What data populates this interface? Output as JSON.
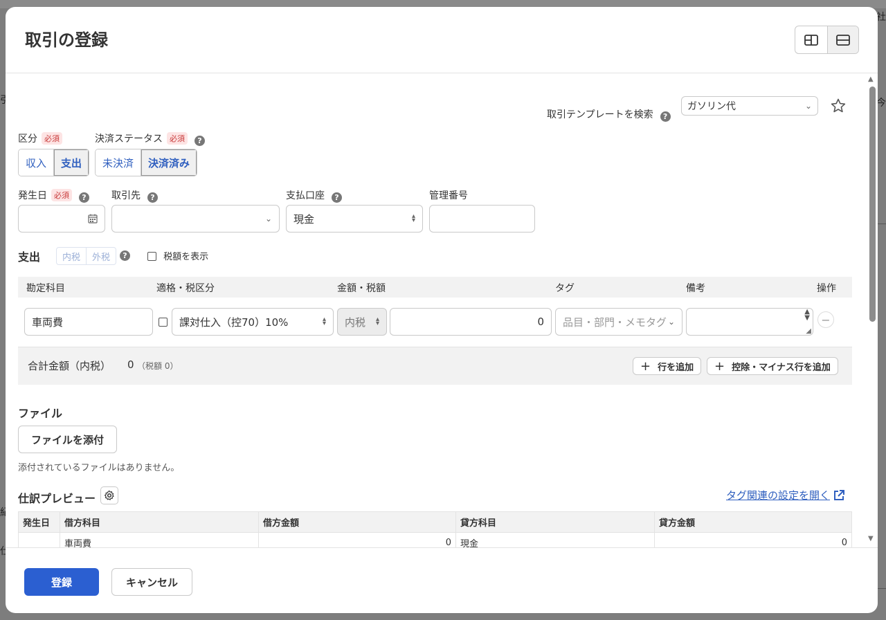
{
  "modal": {
    "title": "取引の登録"
  },
  "template_search": {
    "label": "取引テンプレートを検索",
    "value": "ガソリン代"
  },
  "kubun": {
    "label": "区分",
    "required": "必須",
    "options": [
      "収入",
      "支出"
    ],
    "selected": "支出"
  },
  "status": {
    "label": "決済ステータス",
    "required": "必須",
    "options": [
      "未決済",
      "決済済み"
    ],
    "selected": "決済済み"
  },
  "fields": {
    "date_label": "発生日",
    "date_required": "必須",
    "date_value": "",
    "partner_label": "取引先",
    "partner_value": "",
    "account_label": "支払口座",
    "account_value": "現金",
    "mgmt_label": "管理番号",
    "mgmt_value": ""
  },
  "expense": {
    "title": "支出",
    "tax_options": [
      "内税",
      "外税"
    ],
    "show_tax_label": "税額を表示",
    "columns": [
      "勘定科目",
      "適格・税区分",
      "金額・税額",
      "タグ",
      "備考",
      "操作"
    ],
    "row": {
      "account": "車両費",
      "tax_class": "課対仕入（控70）10%",
      "tax_mode": "内税",
      "amount": "0",
      "tag_placeholder": "品目・部門・メモタグ",
      "memo": ""
    },
    "total_label": "合計金額（内税）",
    "total_value": "0",
    "tax_note": "（税額 0）",
    "add_row": "行を追加",
    "add_minus_row": "控除・マイナス行を追加"
  },
  "file": {
    "title": "ファイル",
    "attach_button": "ファイルを添付",
    "empty_text": "添付されているファイルはありません。"
  },
  "journal": {
    "title": "仕訳プレビュー",
    "tag_link": "タグ関連の設定を開く",
    "columns": [
      "発生日",
      "借方科目",
      "借方金額",
      "貸方科目",
      "貸方金額"
    ],
    "rows": [
      {
        "date": "",
        "debit_account": "車両費",
        "debit_amount": "0",
        "credit_account": "現金",
        "credit_amount": "0"
      }
    ]
  },
  "footer": {
    "submit": "登録",
    "cancel": "キャンセル"
  },
  "background": {
    "right_top": "社",
    "right_mid": "今",
    "left_mid": "引",
    "left_low": "紀",
    "left_bottom": "仕"
  },
  "colors": {
    "primary": "#2b5fd1",
    "link": "#2f5fbf",
    "required_badge": "#c83a3a"
  }
}
